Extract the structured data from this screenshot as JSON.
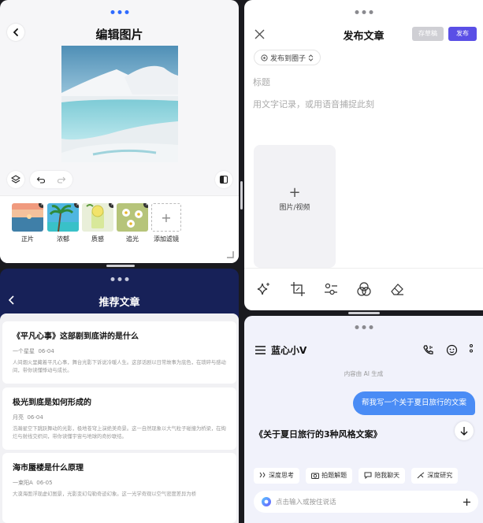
{
  "edit_image": {
    "title": "编辑图片",
    "filters": [
      {
        "label": "正片",
        "removable": true
      },
      {
        "label": "浓郁",
        "removable": true
      },
      {
        "label": "质感",
        "removable": true
      },
      {
        "label": "追光",
        "removable": true
      },
      {
        "label": "添加滤镜",
        "removable": false
      }
    ]
  },
  "publish": {
    "title": "发布文章",
    "draft_label": "存草稿",
    "publish_label": "发布",
    "circle_label": "发布到圈子",
    "title_placeholder": "标题",
    "body_placeholder": "用文字记录，或用语音捕捉此刻",
    "media_label": "图片/视频",
    "tools": [
      "sparkle-icon",
      "crop-icon",
      "adjust-icon",
      "filter-icon",
      "eraser-icon"
    ]
  },
  "recommended": {
    "title": "推荐文章",
    "articles": [
      {
        "title": "《平凡心事》这部剧到底讲的是什么",
        "author": "一个星星",
        "date": "06-04",
        "summary": "人间烟火里藏着平凡心事，舞台光影下诉说冷暖人生。这部话剧以日常故事为底色，在琐碎与感动间，带你读懂悸动与成长。"
      },
      {
        "title": "极光到底是如何形成的",
        "author": "月亮",
        "date": "06-04",
        "summary": "浩瀚星空下跳跃舞动的光影，极地苍穹上演绝美奇景。这一自然现象以大气粒子碰撞为桥梁，在绚烂与射线交织间，带你读懂宇宙与地球的奇妙联结。"
      },
      {
        "title": "海市蜃楼是什么原理",
        "author": "一束阳A",
        "date": "06-05",
        "summary": "大漠海面浮现虚幻图景，光影变幻勾勒奇迹幻象。这一光学奇观以空气密度差异为桥"
      }
    ]
  },
  "chat": {
    "assistant_name": "蓝心小V",
    "generated_note": "内容由 AI 生成",
    "user_message": "帮我写一个关于夏日旅行的文案",
    "reply_title": "《关于夏日旅行的3种风格文案》",
    "quick_actions": [
      {
        "label": "深度思考",
        "icon": "think-icon"
      },
      {
        "label": "拍题解题",
        "icon": "camera-icon"
      },
      {
        "label": "陪我聊天",
        "icon": "chat-icon"
      },
      {
        "label": "深度研究",
        "icon": "research-icon"
      }
    ],
    "input_placeholder": "点击输入或按住说话"
  }
}
